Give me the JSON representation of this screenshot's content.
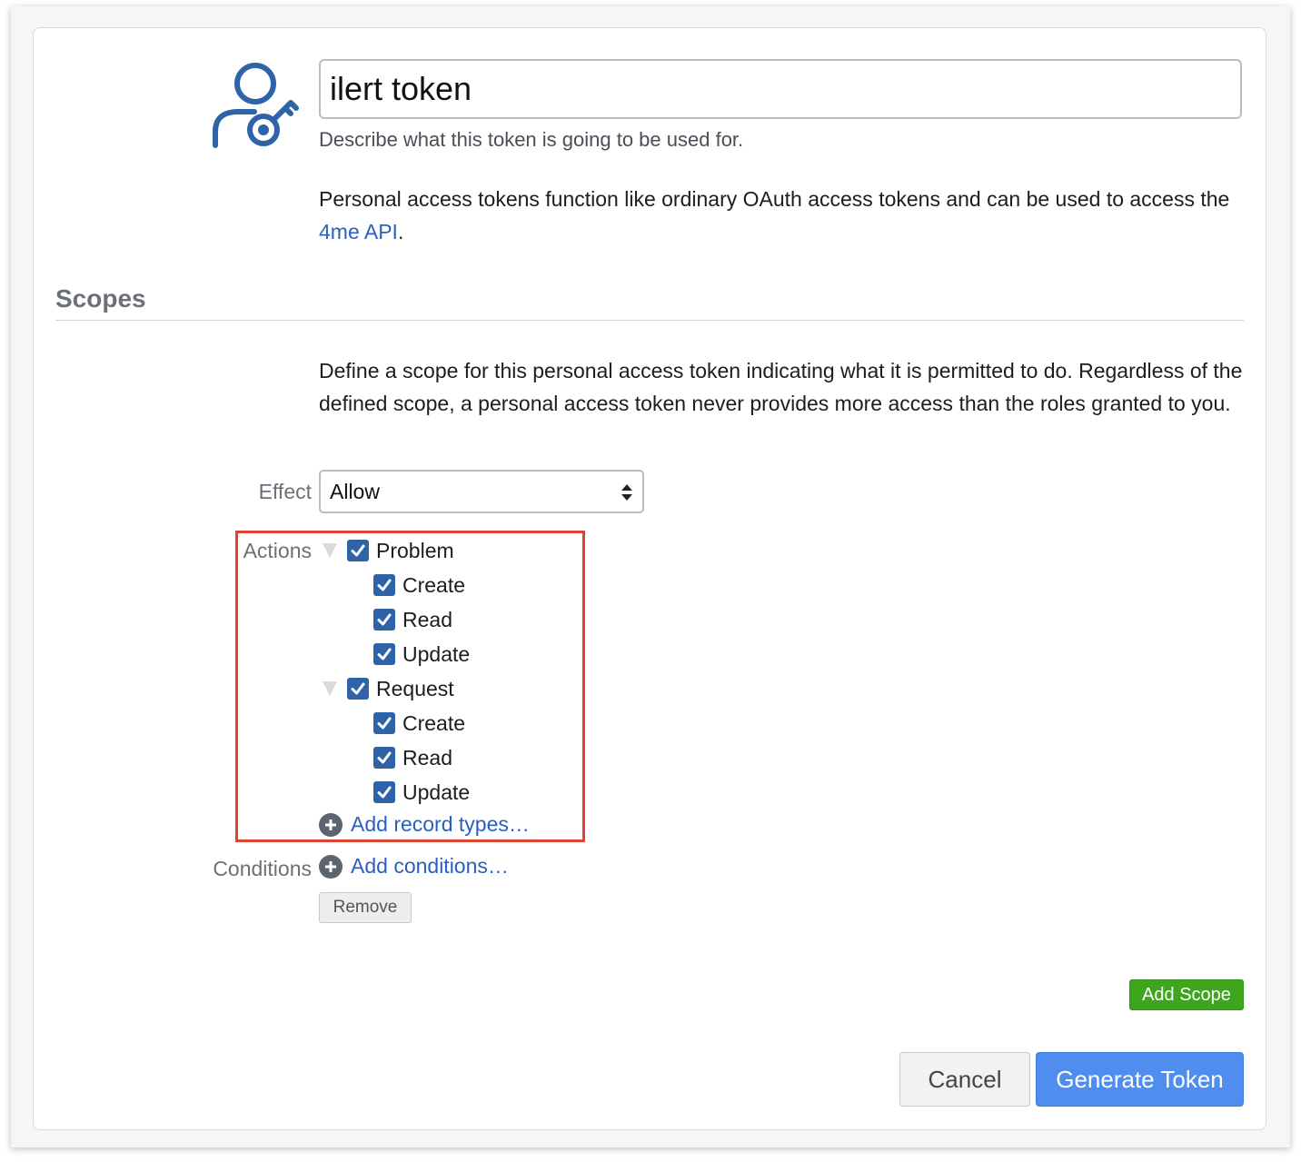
{
  "token": {
    "name_value": "ilert token",
    "hint": "Describe what this token is going to be used for."
  },
  "intro": {
    "text_before": "Personal access tokens function like ordinary OAuth access tokens and can be used to access the ",
    "link": "4me API",
    "text_after": "."
  },
  "scopes": {
    "title": "Scopes",
    "description": "Define a scope for this personal access token indicating what it is permitted to do. Regardless of the defined scope, a personal access token never provides more access than the roles granted to you.",
    "effect_label": "Effect",
    "effect_value": "Allow",
    "actions_label": "Actions",
    "groups": [
      {
        "label": "Problem",
        "checked": true,
        "children": [
          {
            "label": "Create",
            "checked": true
          },
          {
            "label": "Read",
            "checked": true
          },
          {
            "label": "Update",
            "checked": true
          }
        ]
      },
      {
        "label": "Request",
        "checked": true,
        "children": [
          {
            "label": "Create",
            "checked": true
          },
          {
            "label": "Read",
            "checked": true
          },
          {
            "label": "Update",
            "checked": true
          }
        ]
      }
    ],
    "add_record_types": "Add record types…",
    "conditions_label": "Conditions",
    "add_conditions": "Add conditions…",
    "remove_label": "Remove",
    "add_scope_label": "Add Scope"
  },
  "footer": {
    "cancel_label": "Cancel",
    "generate_label": "Generate Token"
  },
  "colors": {
    "checkbox": "#2f63a8",
    "link": "#2a5fc1",
    "highlight": "#e0432f",
    "add_scope": "#3ea51f",
    "primary": "#4f8ef0"
  },
  "icons": {
    "avatar": "user-key-icon",
    "select": "select-arrows-icon",
    "expand": "triangle-down-icon",
    "check": "checkmark-icon",
    "add": "plus-circle-icon"
  }
}
